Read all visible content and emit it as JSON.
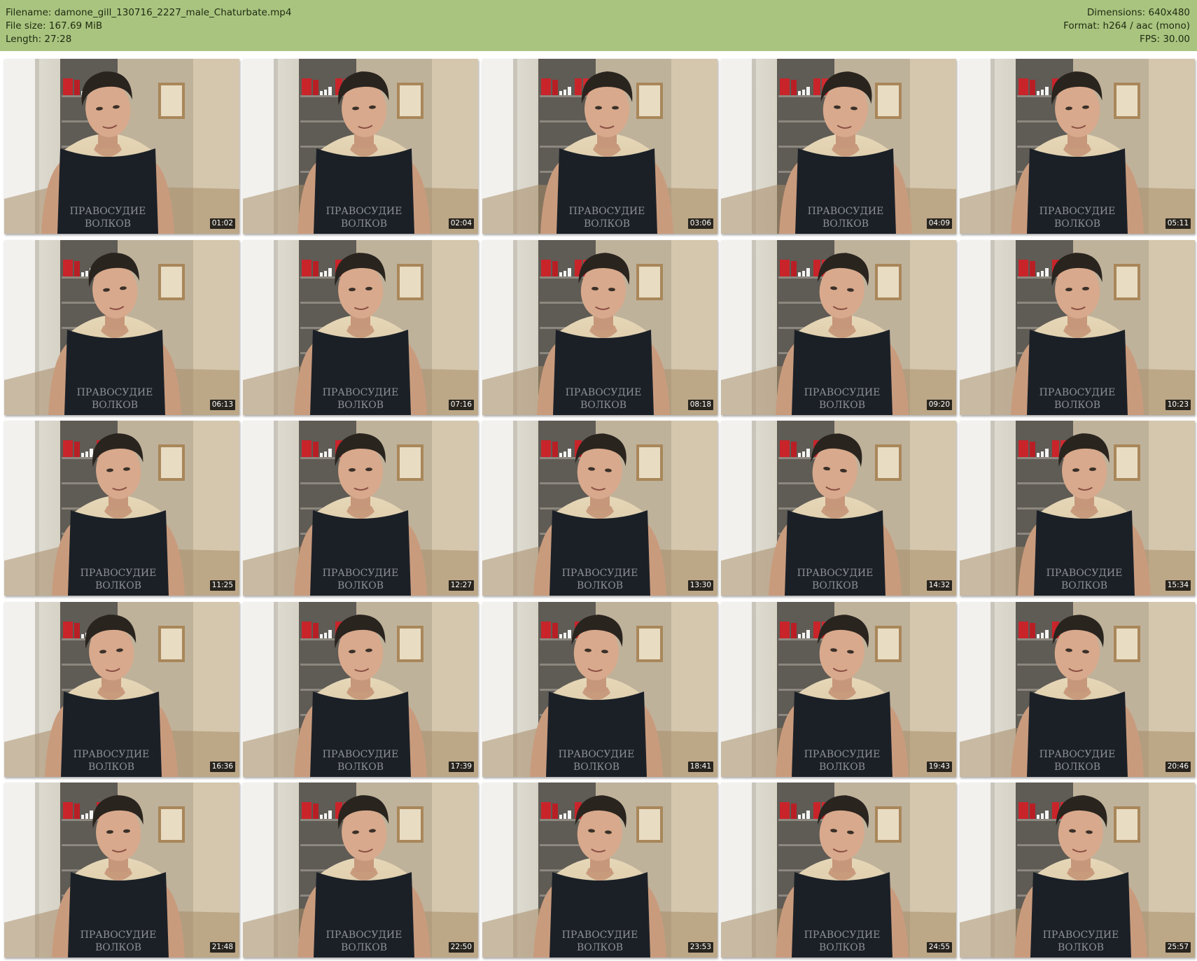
{
  "header": {
    "filename": "Filename: damone_gill_130716_2227_male_Chaturbate.mp4",
    "filesize": "File size: 167.69 MiB",
    "length": "Length: 27:28",
    "dimensions": "Dimensions: 640x480",
    "format": "Format: h264 / aac (mono)",
    "fps": "FPS: 30.00"
  },
  "thumbnails": [
    {
      "timestamp": "01:02",
      "shirt_text": "ПРАВОСУДИЕ",
      "shirt_text_2": "ВОЛКОВ",
      "head_dx": -20,
      "head_tilt": -6
    },
    {
      "timestamp": "02:04",
      "shirt_text": "ПРАВОСУДИЕ",
      "shirt_text_2": "ВОЛКОВ",
      "head_dx": 5,
      "head_tilt": -4
    },
    {
      "timestamp": "03:06",
      "shirt_text": "ПРАВОСУДИЕ",
      "shirt_text_2": "ВОЛКОВ",
      "head_dx": 10,
      "head_tilt": 0
    },
    {
      "timestamp": "04:09",
      "shirt_text": "ПРАВОСУДИЕ",
      "shirt_text_2": "ВОЛКОВ",
      "head_dx": 10,
      "head_tilt": 4
    },
    {
      "timestamp": "05:11",
      "shirt_text": "ПРАВОСУДИЕ",
      "shirt_text_2": "ВОЛКОВ",
      "head_dx": 0,
      "head_tilt": -4
    },
    {
      "timestamp": "06:13",
      "shirt_text": "ПРАВОСУДИЕ",
      "shirt_text_2": "ВОЛКОВ",
      "head_dx": -10,
      "head_tilt": -6
    },
    {
      "timestamp": "07:16",
      "shirt_text": "ПРАВОСУДИЕ",
      "shirt_text_2": "ВОЛКОВ",
      "head_dx": 0,
      "head_tilt": -3
    },
    {
      "timestamp": "08:18",
      "shirt_text": "ПРАВОСУДИЕ",
      "shirt_text_2": "ВОЛКОВ",
      "head_dx": 5,
      "head_tilt": 3
    },
    {
      "timestamp": "09:20",
      "shirt_text": "ПРАВОСУДИЕ",
      "shirt_text_2": "ВОЛКОВ",
      "head_dx": 5,
      "head_tilt": 6
    },
    {
      "timestamp": "10:23",
      "shirt_text": "ПРАВОСУДИЕ",
      "shirt_text_2": "ВОЛКОВ",
      "head_dx": 0,
      "head_tilt": -3
    },
    {
      "timestamp": "11:25",
      "shirt_text": "ПРАВОСУДИЕ",
      "shirt_text_2": "ВОЛКОВ",
      "head_dx": -5,
      "head_tilt": -4
    },
    {
      "timestamp": "12:27",
      "shirt_text": "ПРАВОСУДИЕ",
      "shirt_text_2": "ВОЛКОВ",
      "head_dx": 0,
      "head_tilt": -2
    },
    {
      "timestamp": "13:30",
      "shirt_text": "ПРАВОСУДИЕ",
      "shirt_text_2": "ВОЛКОВ",
      "head_dx": 0,
      "head_tilt": 5
    },
    {
      "timestamp": "14:32",
      "shirt_text": "ПРАВОСУДИЕ",
      "shirt_text_2": "ВОЛКОВ",
      "head_dx": -5,
      "head_tilt": 7
    },
    {
      "timestamp": "15:34",
      "shirt_text": "ПРАВОСУДИЕ",
      "shirt_text_2": "ВОЛКОВ",
      "head_dx": 10,
      "head_tilt": -3
    },
    {
      "timestamp": "16:36",
      "shirt_text": "ПРАВОСУДИЕ",
      "shirt_text_2": "ВОЛКОВ",
      "head_dx": -15,
      "head_tilt": -5
    },
    {
      "timestamp": "17:39",
      "shirt_text": "ПРАВОСУДИЕ",
      "shirt_text_2": "ВОЛКОВ",
      "head_dx": 0,
      "head_tilt": -4
    },
    {
      "timestamp": "18:41",
      "shirt_text": "ПРАВОСУДИЕ",
      "shirt_text_2": "ВОЛКОВ",
      "head_dx": -5,
      "head_tilt": 4
    },
    {
      "timestamp": "19:43",
      "shirt_text": "ПРАВОСУДИЕ",
      "shirt_text_2": "ВОЛКОВ",
      "head_dx": 5,
      "head_tilt": 6
    },
    {
      "timestamp": "20:46",
      "shirt_text": "ПРАВОСУДИЕ",
      "shirt_text_2": "ВОЛКОВ",
      "head_dx": 0,
      "head_tilt": 5
    },
    {
      "timestamp": "21:48",
      "shirt_text": "ПРАВОСУДИЕ",
      "shirt_text_2": "ВОЛКОВ",
      "head_dx": -5,
      "head_tilt": -3
    },
    {
      "timestamp": "22:50",
      "shirt_text": "ПРАВОСУДИЕ",
      "shirt_text_2": "ВОЛКОВ",
      "head_dx": 5,
      "head_tilt": -5
    },
    {
      "timestamp": "23:53",
      "shirt_text": "ПРАВОСУДИЕ",
      "shirt_text_2": "ВОЛКОВ",
      "head_dx": 0,
      "head_tilt": 5
    },
    {
      "timestamp": "24:55",
      "shirt_text": "ПРАВОСУДИЕ",
      "shirt_text_2": "ВОЛКОВ",
      "head_dx": 5,
      "head_tilt": 6
    },
    {
      "timestamp": "25:57",
      "shirt_text": "ПРАВОСУДИЕ",
      "shirt_text_2": "ВОЛКОВ",
      "head_dx": 5,
      "head_tilt": 4
    }
  ]
}
